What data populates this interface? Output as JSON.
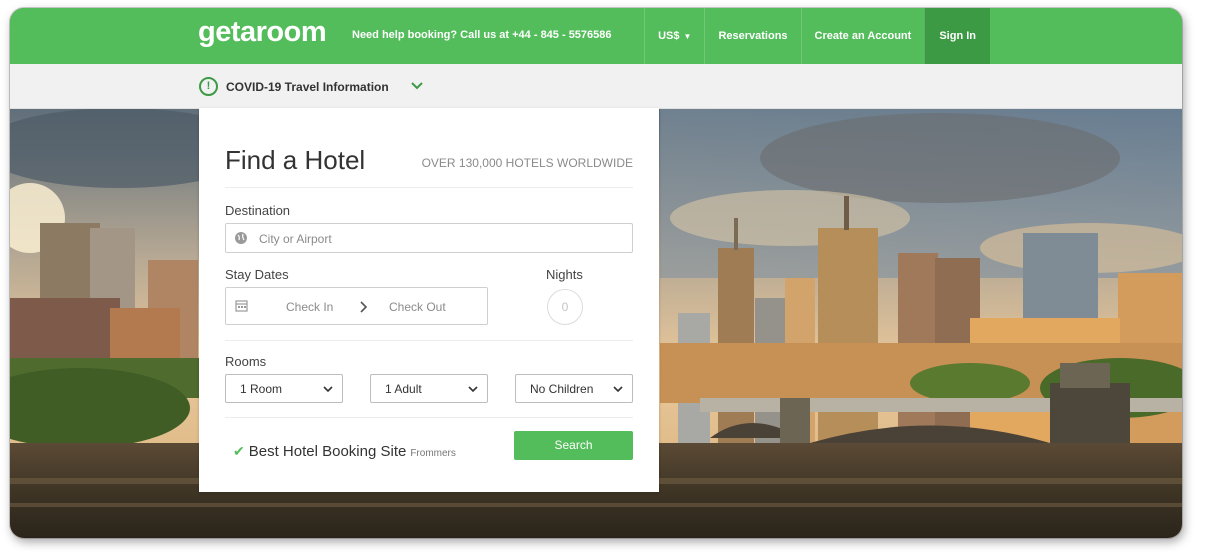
{
  "header": {
    "logo": "getaroom",
    "help_text": "Need help booking? Call us at +44 - 845 - 5576586",
    "nav": {
      "currency": "US$",
      "reservations": "Reservations",
      "create_account": "Create an Account",
      "sign_in": "Sign In"
    }
  },
  "covid": {
    "label": "COVID-19 Travel Information"
  },
  "search": {
    "title": "Find a Hotel",
    "subtitle": "OVER 130,000 HOTELS WORLDWIDE",
    "destination": {
      "label": "Destination",
      "placeholder": "City or Airport"
    },
    "dates": {
      "label": "Stay Dates",
      "check_in": "Check In",
      "check_out": "Check Out"
    },
    "nights": {
      "label": "Nights",
      "value": "0"
    },
    "rooms": {
      "label": "Rooms",
      "rooms_value": "1 Room",
      "adults_value": "1 Adult",
      "children_value": "No Children"
    },
    "badge": {
      "text": "Best Hotel Booking Site",
      "source": "Frommers"
    },
    "button": "Search"
  },
  "colors": {
    "brand_green": "#52bd5a",
    "brand_green_dark": "#3c9a45"
  },
  "icons": {
    "covid": "alert-circle-icon",
    "covid_toggle": "chevron-down-icon",
    "destination": "globe-icon",
    "dates": "calendar-icon",
    "date_separator": "chevron-right-icon",
    "select": "caret-down-icon",
    "badge": "checkmark-icon"
  }
}
